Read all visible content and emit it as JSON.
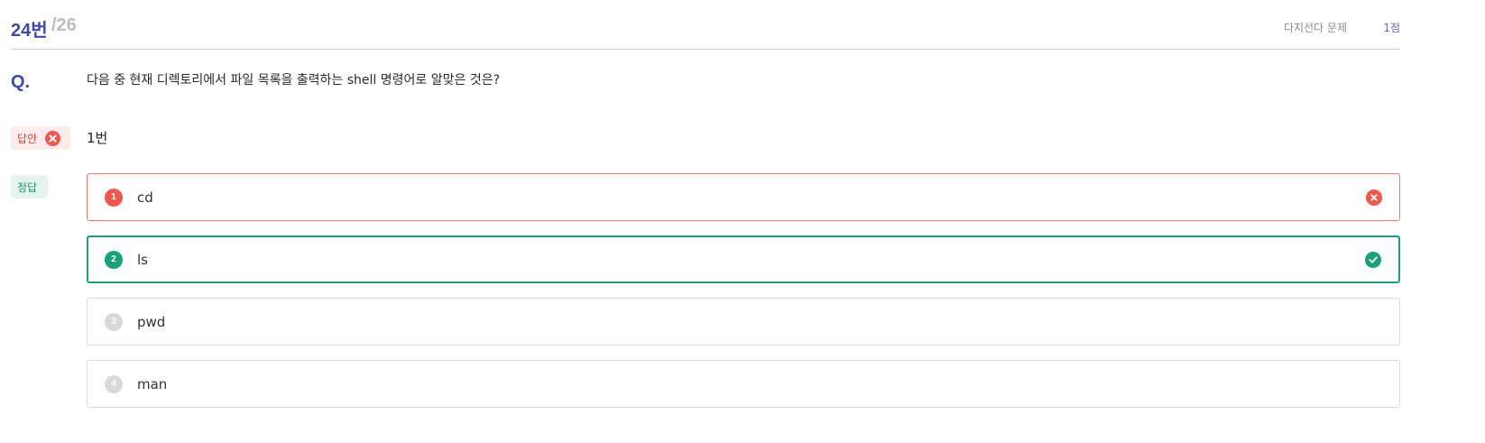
{
  "header": {
    "question_number": "24번",
    "question_total": "/26",
    "question_type": "다지선다 문제",
    "points": "1점"
  },
  "question": {
    "mark": "Q.",
    "text": "다음 중 현재 디렉토리에서 파일 목록을 출력하는 shell 명령어로 알맞은 것은?"
  },
  "user_answer": {
    "badge_label": "답안",
    "status": "wrong",
    "value": "1번"
  },
  "correct_answer": {
    "badge_label": "정답"
  },
  "options": [
    {
      "number": "1",
      "label": "cd",
      "state": "wrong"
    },
    {
      "number": "2",
      "label": "ls",
      "state": "correct"
    },
    {
      "number": "3",
      "label": "pwd",
      "state": "neutral"
    },
    {
      "number": "4",
      "label": "man",
      "state": "neutral"
    }
  ],
  "colors": {
    "accent": "#3e4aa8",
    "wrong": "#f0584e",
    "correct": "#1aa07a",
    "neutral": "#d9d9d9"
  }
}
